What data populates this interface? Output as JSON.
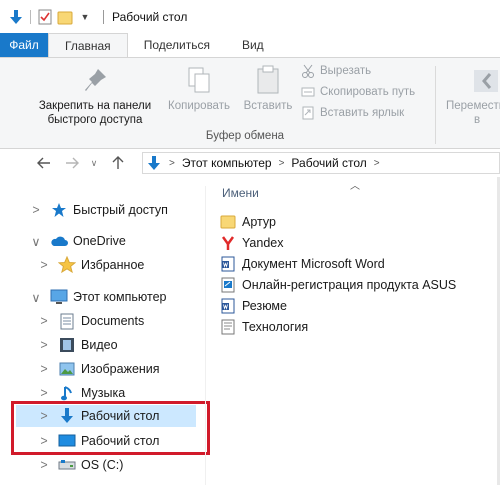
{
  "window": {
    "title": "Рабочий стол"
  },
  "tabs": [
    {
      "label": "Файл"
    },
    {
      "label": "Главная"
    },
    {
      "label": "Поделиться"
    },
    {
      "label": "Вид"
    }
  ],
  "ribbon": {
    "pin_label_1": "Закрепить на панели",
    "pin_label_2": "быстрого доступа",
    "copy_label": "Копировать",
    "paste_label": "Вставить",
    "cut_label": "Вырезать",
    "copy_path_label": "Скопировать путь",
    "paste_shortcut_label": "Вставить ярлык",
    "group_label": "Буфер обмена",
    "move_label": "Переместить",
    "move_sub": "в"
  },
  "address": {
    "crumbs": [
      "Этот компьютер",
      "Рабочий стол"
    ]
  },
  "nav": {
    "quick_access": "Быстрый доступ",
    "onedrive": "OneDrive",
    "favorites": "Избранное",
    "this_pc": "Этот компьютер",
    "documents": "Documents",
    "video": "Видео",
    "images": "Изображения",
    "music": "Музыка",
    "desktop_1": "Рабочий стол",
    "desktop_2": "Рабочий стол",
    "drive_c": "OS (C:)"
  },
  "files": {
    "header": "Имени",
    "items": [
      "Артур",
      "Yandex",
      "Документ Microsoft Word",
      "Онлайн-регистрация продукта ASUS",
      "Резюме",
      "Технология"
    ]
  },
  "colors": {
    "accent": "#1979ca",
    "selection": "#cce8ff",
    "highlight_box": "#d11a2a",
    "folder": "#f8d775"
  }
}
